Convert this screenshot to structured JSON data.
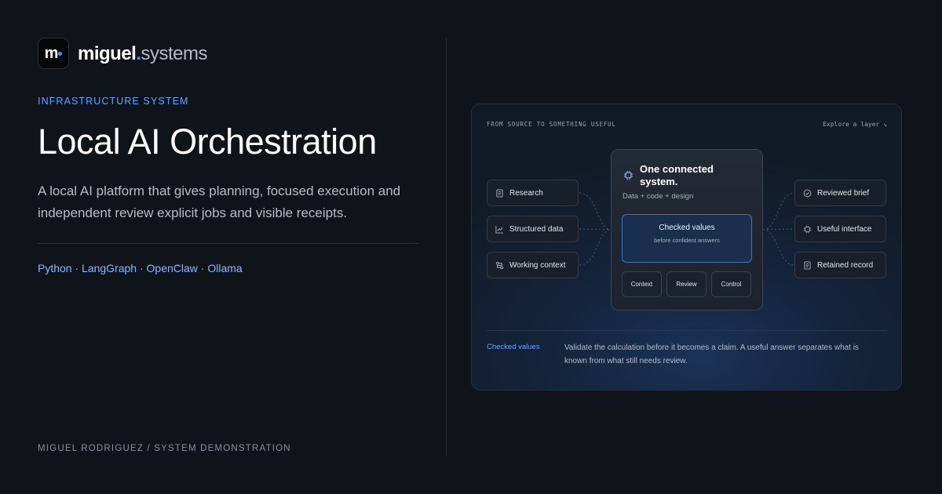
{
  "brand": {
    "logo_mark": "m",
    "name_bold": "miguel",
    "name_dot": ".",
    "name_light": "systems"
  },
  "hero": {
    "eyebrow": "INFRASTRUCTURE SYSTEM",
    "title": "Local AI Orchestration",
    "description": "A local AI platform that gives planning, focused execution and independent review explicit jobs and visible receipts.",
    "stack": "Python · LangGraph · OpenClaw · Ollama",
    "footer": "MIGUEL RODRIGUEZ / SYSTEM DEMONSTRATION"
  },
  "diagram": {
    "eyebrow": "FROM SOURCE TO SOMETHING USEFUL",
    "explore_link": "Explore a layer ↘",
    "inputs": [
      {
        "label": "Research",
        "icon": "document-icon"
      },
      {
        "label": "Structured data",
        "icon": "line-chart-icon"
      },
      {
        "label": "Working context",
        "icon": "route-icon"
      }
    ],
    "center": {
      "icon": "chip-icon",
      "title": "One connected system.",
      "subtitle": "Data + code + design",
      "checked_title": "Checked values",
      "checked_subtitle": "before confident answers",
      "layers": [
        "Context",
        "Review",
        "Control"
      ]
    },
    "outputs": [
      {
        "label": "Reviewed brief",
        "icon": "check-circle-icon"
      },
      {
        "label": "Useful interface",
        "icon": "chip-icon"
      },
      {
        "label": "Retained record",
        "icon": "document-icon"
      }
    ],
    "detail": {
      "label": "Checked values",
      "text": "Validate the calculation before it becomes a claim. A useful answer separates what is known from what still needs review."
    }
  },
  "colors": {
    "background": "#0f131a",
    "accent": "#4a8cff",
    "eyebrow": "#6aa3ff"
  }
}
